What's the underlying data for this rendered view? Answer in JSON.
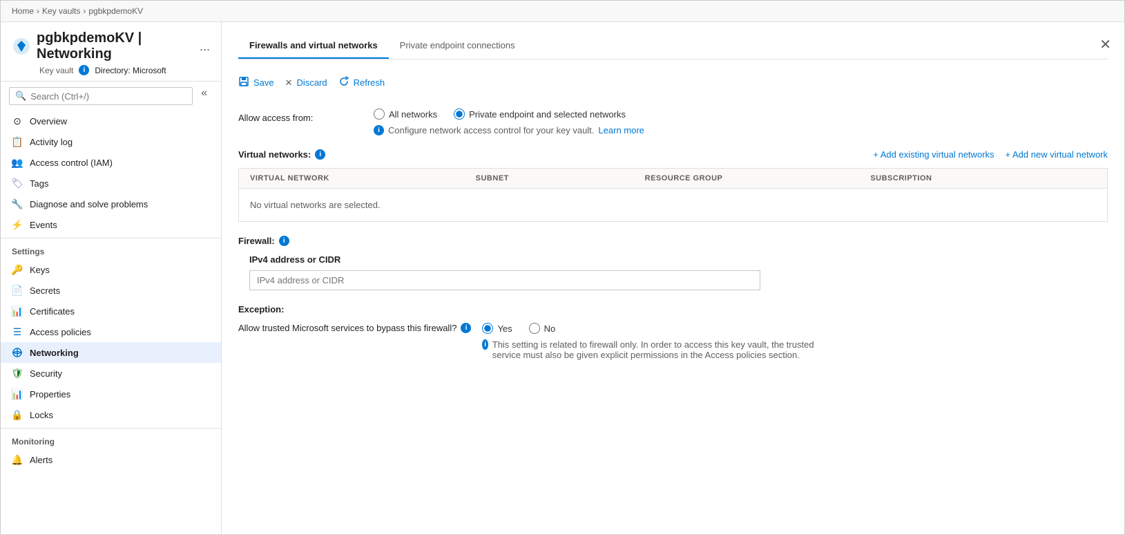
{
  "breadcrumb": {
    "home": "Home",
    "keyVaults": "Key vaults",
    "resource": "pgbkpdemoKV"
  },
  "header": {
    "title": "pgbkpdemoKV | Networking",
    "resourceType": "Key vault",
    "directory": "Directory: Microsoft",
    "moreOptions": "..."
  },
  "sidebar": {
    "searchPlaceholder": "Search (Ctrl+/)",
    "items": [
      {
        "id": "overview",
        "label": "Overview",
        "icon": "⊙"
      },
      {
        "id": "activity-log",
        "label": "Activity log",
        "icon": "📋"
      },
      {
        "id": "access-control",
        "label": "Access control (IAM)",
        "icon": "👥"
      },
      {
        "id": "tags",
        "label": "Tags",
        "icon": "🏷"
      },
      {
        "id": "diagnose",
        "label": "Diagnose and solve problems",
        "icon": "🔧"
      },
      {
        "id": "events",
        "label": "Events",
        "icon": "⚡"
      }
    ],
    "settingsLabel": "Settings",
    "settingsItems": [
      {
        "id": "keys",
        "label": "Keys",
        "icon": "🔑"
      },
      {
        "id": "secrets",
        "label": "Secrets",
        "icon": "📄"
      },
      {
        "id": "certificates",
        "label": "Certificates",
        "icon": "📊"
      },
      {
        "id": "access-policies",
        "label": "Access policies",
        "icon": "☰"
      },
      {
        "id": "networking",
        "label": "Networking",
        "icon": "🔗",
        "active": true
      },
      {
        "id": "security",
        "label": "Security",
        "icon": "🛡"
      },
      {
        "id": "properties",
        "label": "Properties",
        "icon": "📊"
      },
      {
        "id": "locks",
        "label": "Locks",
        "icon": "🔒"
      }
    ],
    "monitoringLabel": "Monitoring",
    "monitoringItems": [
      {
        "id": "alerts",
        "label": "Alerts",
        "icon": "🔔"
      }
    ]
  },
  "tabs": [
    {
      "id": "firewalls",
      "label": "Firewalls and virtual networks",
      "active": true
    },
    {
      "id": "private-endpoints",
      "label": "Private endpoint connections",
      "active": false
    }
  ],
  "toolbar": {
    "saveLabel": "Save",
    "discardLabel": "Discard",
    "refreshLabel": "Refresh"
  },
  "allowAccess": {
    "label": "Allow access from:",
    "options": [
      {
        "id": "all-networks",
        "label": "All networks",
        "selected": false
      },
      {
        "id": "private-selected",
        "label": "Private endpoint and selected networks",
        "selected": true
      }
    ],
    "infoText": "Configure network access control for your key vault.",
    "learnMoreLabel": "Learn more"
  },
  "virtualNetworks": {
    "label": "Virtual networks:",
    "addExistingLabel": "+ Add existing virtual networks",
    "addNewLabel": "+ Add new virtual network",
    "columns": [
      "VIRTUAL NETWORK",
      "SUBNET",
      "RESOURCE GROUP",
      "SUBSCRIPTION"
    ],
    "emptyText": "No virtual networks are selected."
  },
  "firewall": {
    "label": "Firewall:",
    "ipv4Label": "IPv4 address or CIDR",
    "ipv4Placeholder": "IPv4 address or CIDR"
  },
  "exception": {
    "label": "Exception:",
    "questionLabel": "Allow trusted Microsoft services to bypass this firewall?",
    "yesLabel": "Yes",
    "noLabel": "No",
    "yesSelected": true,
    "infoText": "This setting is related to firewall only. In order to access this key vault, the trusted service must also be given explicit permissions in the Access policies section."
  }
}
